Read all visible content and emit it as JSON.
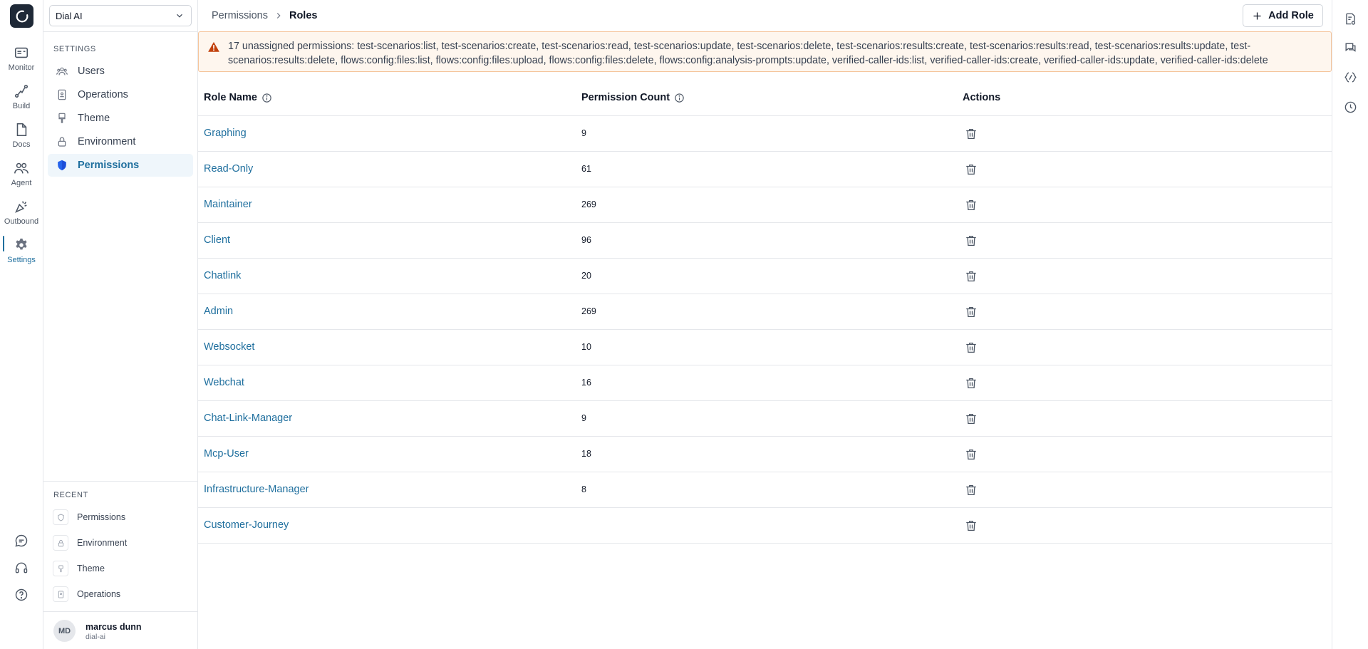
{
  "app": {
    "logo": "dial-logo-icon"
  },
  "rail": {
    "items": [
      {
        "label": "Monitor",
        "icon": "monitor-icon"
      },
      {
        "label": "Build",
        "icon": "build-icon"
      },
      {
        "label": "Docs",
        "icon": "docs-icon"
      },
      {
        "label": "Agent",
        "icon": "agent-icon"
      },
      {
        "label": "Outbound",
        "icon": "outbound-icon"
      },
      {
        "label": "Settings",
        "icon": "gear-icon",
        "active": true
      }
    ],
    "bottom_icons": [
      "chat-icon",
      "headset-icon",
      "help-icon"
    ]
  },
  "sidebar": {
    "org_selector": {
      "value": "Dial AI"
    },
    "section_label": "SETTINGS",
    "items": [
      {
        "label": "Users",
        "icon": "users-icon"
      },
      {
        "label": "Operations",
        "icon": "operations-icon"
      },
      {
        "label": "Theme",
        "icon": "theme-icon"
      },
      {
        "label": "Environment",
        "icon": "lock-icon"
      },
      {
        "label": "Permissions",
        "icon": "shield-icon",
        "active": true
      }
    ],
    "recent_label": "RECENT",
    "recent": [
      {
        "label": "Permissions",
        "icon": "shield-icon"
      },
      {
        "label": "Environment",
        "icon": "lock-icon"
      },
      {
        "label": "Theme",
        "icon": "theme-icon"
      },
      {
        "label": "Operations",
        "icon": "operations-icon"
      }
    ],
    "user": {
      "initials": "MD",
      "name": "marcus dunn",
      "org": "dial-ai"
    }
  },
  "header": {
    "breadcrumb": {
      "parent": "Permissions",
      "current": "Roles"
    },
    "add_role_label": "Add Role"
  },
  "warning": {
    "text": "17 unassigned permissions: test-scenarios:list, test-scenarios:create, test-scenarios:read, test-scenarios:update, test-scenarios:delete, test-scenarios:results:create, test-scenarios:results:read, test-scenarios:results:update, test-scenarios:results:delete, flows:config:files:list, flows:config:files:upload, flows:config:files:delete, flows:config:analysis-prompts:update, verified-caller-ids:list, verified-caller-ids:create, verified-caller-ids:update, verified-caller-ids:delete"
  },
  "table": {
    "headers": {
      "name": "Role Name",
      "count": "Permission Count",
      "actions": "Actions"
    },
    "rows": [
      {
        "name": "Graphing",
        "count": "9"
      },
      {
        "name": "Read-Only",
        "count": "61"
      },
      {
        "name": "Maintainer",
        "count": "269"
      },
      {
        "name": "Client",
        "count": "96"
      },
      {
        "name": "Chatlink",
        "count": "20"
      },
      {
        "name": "Admin",
        "count": "269"
      },
      {
        "name": "Websocket",
        "count": "10"
      },
      {
        "name": "Webchat",
        "count": "16"
      },
      {
        "name": "Chat-Link-Manager",
        "count": "9"
      },
      {
        "name": "Mcp-User",
        "count": "18"
      },
      {
        "name": "Infrastructure-Manager",
        "count": "8"
      },
      {
        "name": "Customer-Journey",
        "count": ""
      }
    ]
  },
  "right_rail": {
    "icons": [
      "notes-icon",
      "comments-icon",
      "flow-icon",
      "history-icon"
    ]
  },
  "colors": {
    "accent": "#1f6f9e",
    "warning_bg": "#fef6ee",
    "warning_border": "#f5c49a",
    "warning_icon": "#c2410c"
  }
}
